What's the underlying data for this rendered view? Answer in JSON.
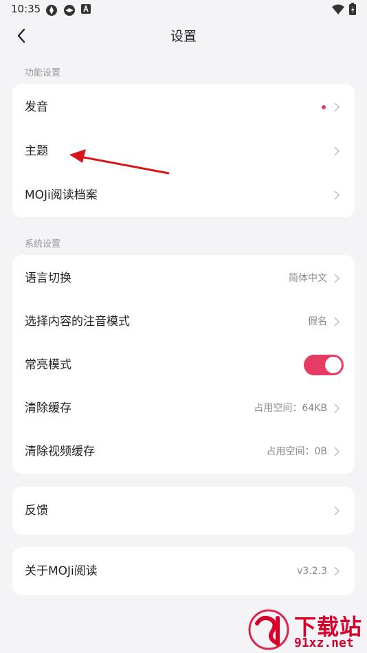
{
  "status_bar": {
    "time": "10:35"
  },
  "header": {
    "title": "设置"
  },
  "colors": {
    "accent": "#e83b63",
    "arrow": "#d7141b",
    "watermark": "#d8002a"
  },
  "sections": {
    "function": {
      "label": "功能设置",
      "items": [
        {
          "label": "发音",
          "has_dot": true
        },
        {
          "label": "主题"
        },
        {
          "label": "MOJi阅读档案"
        }
      ]
    },
    "system": {
      "label": "系统设置",
      "items": [
        {
          "label": "语言切换",
          "value": "简体中文"
        },
        {
          "label": "选择内容的注音模式",
          "value": "假名"
        },
        {
          "label": "常亮模式",
          "toggle_on": true
        },
        {
          "label": "清除缓存",
          "value": "占用空间：64KB"
        },
        {
          "label": "清除视频缓存",
          "value": "占用空间：0B"
        }
      ]
    },
    "feedback": {
      "items": [
        {
          "label": "反馈"
        }
      ]
    },
    "about": {
      "items": [
        {
          "label": "关于MOJi阅读",
          "value": "v3.2.3"
        }
      ]
    }
  },
  "watermark": {
    "title": "下载站",
    "subtitle": "91xz.net"
  }
}
